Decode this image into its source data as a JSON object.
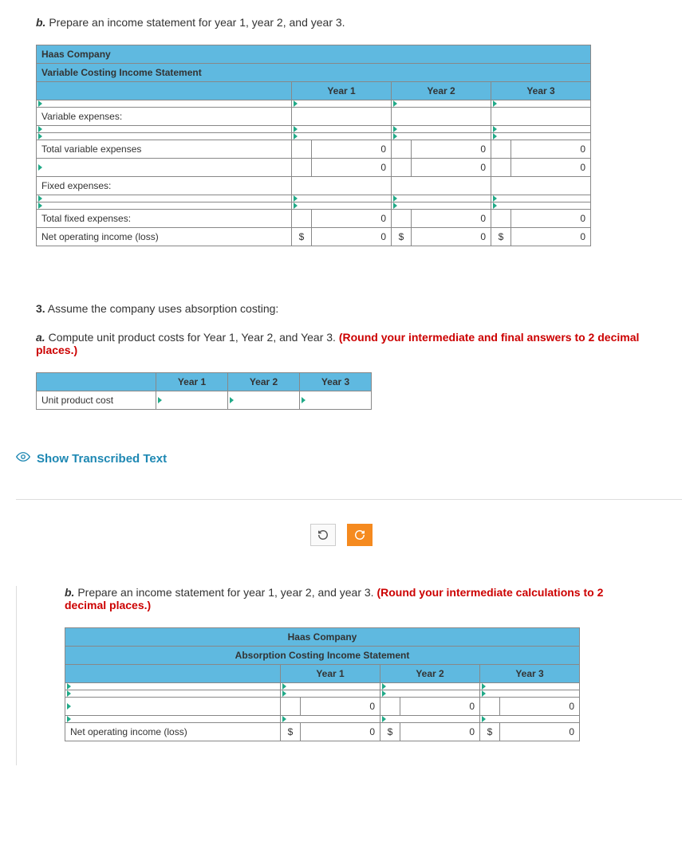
{
  "q_b_top": {
    "letter": "b.",
    "text": " Prepare an income statement for year 1, year 2, and year 3."
  },
  "table1": {
    "company": "Haas Company",
    "title": "Variable Costing Income Statement",
    "h_y1": "Year 1",
    "h_y2": "Year 2",
    "h_y3": "Year 3",
    "rows": {
      "blank1": "",
      "var_exp_label": "Variable expenses:",
      "blank2": "",
      "blank3": "",
      "total_var_exp": "Total variable expenses",
      "blank4": "",
      "fixed_exp_label": "Fixed expenses:",
      "blank5": "",
      "blank6": "",
      "total_fixed": "Total fixed expenses:",
      "net_op": "Net operating income (loss)"
    },
    "vals": {
      "tv_y1": "0",
      "tv_y2": "0",
      "tv_y3": "0",
      "b4_y1": "0",
      "b4_y2": "0",
      "b4_y3": "0",
      "tf_y1": "0",
      "tf_y2": "0",
      "tf_y3": "0",
      "no_y1": "0",
      "no_y2": "0",
      "no_y3": "0",
      "dollar": "$"
    }
  },
  "q3": {
    "prefix": "3.",
    "text": " Assume the company uses absorption costing:",
    "a_letter": "a.",
    "a_text": " Compute unit product costs for Year 1, Year 2, and Year 3. ",
    "a_red": "(Round your intermediate and final answers to 2 decimal places.)"
  },
  "table2": {
    "h_y1": "Year 1",
    "h_y2": "Year 2",
    "h_y3": "Year 3",
    "row_label": "Unit product cost"
  },
  "show_transcribed": "Show Transcribed Text",
  "q_b_bottom": {
    "letter": "b.",
    "text": " Prepare an income statement for year 1, year 2, and year 3. ",
    "red": "(Round your intermediate calculations to 2 decimal places.)"
  },
  "table3": {
    "company": "Haas Company",
    "title": "Absorption Costing Income Statement",
    "h_y1": "Year 1",
    "h_y2": "Year 2",
    "h_y3": "Year 3",
    "rows": {
      "blank1": "",
      "blank2": "",
      "line3": "",
      "blank3": "",
      "net_op": "Net operating income (loss)"
    },
    "vals": {
      "l3_y1": "0",
      "l3_y2": "0",
      "l3_y3": "0",
      "no_y1": "0",
      "no_y2": "0",
      "no_y3": "0",
      "dollar": "$"
    }
  }
}
